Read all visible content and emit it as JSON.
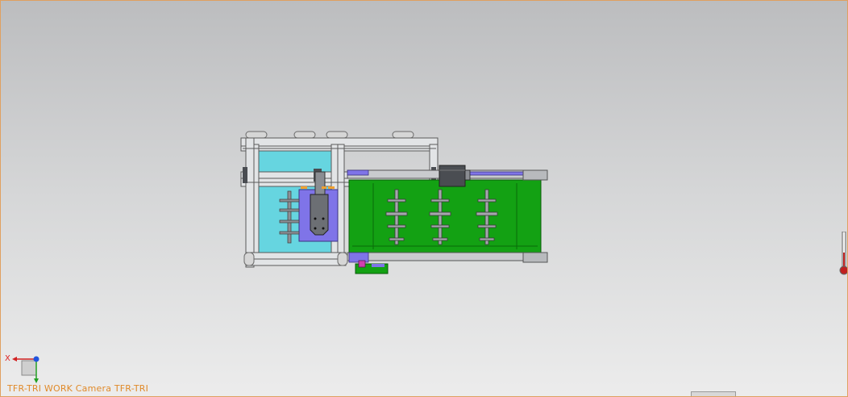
{
  "viewport": {
    "camera_label": "TFR-TRI WORK Camera TFR-TRI",
    "triad": {
      "x_axis_label": "X",
      "x_color": "#d22222",
      "y_color": "#22a022",
      "z_color": "#2255dd"
    }
  },
  "icons": {
    "triad": "coordinate-triad-icon",
    "scroll": "thermometer-slider-icon"
  },
  "colors": {
    "frame": "#e2e4e6",
    "frame_edge": "#5a5a5a",
    "panel_cyan": "#66d5e0",
    "panel_purple": "#7f74e8",
    "conveyor_green": "#13a113",
    "motor": "#4a4d52",
    "background_top": "#bcbdbf",
    "background_bottom": "#ececec",
    "border": "#e0a060"
  }
}
